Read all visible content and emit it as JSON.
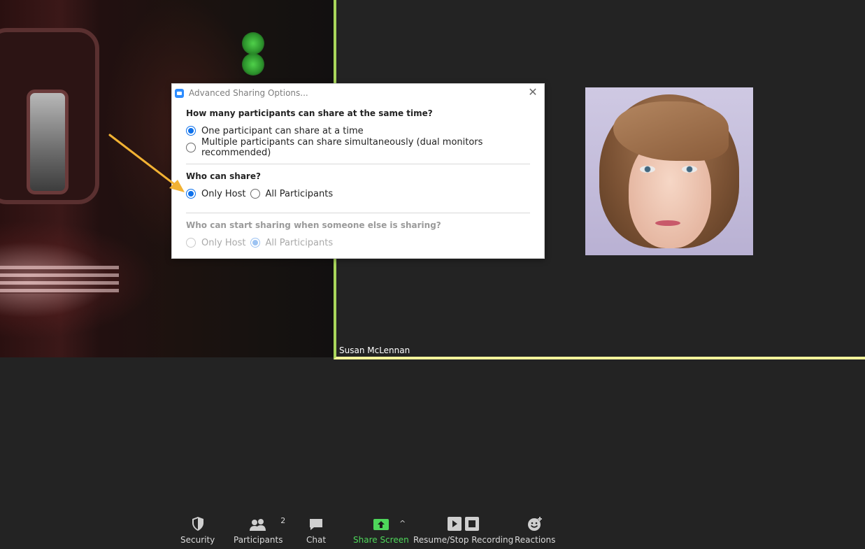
{
  "dialog": {
    "title": "Advanced Sharing Options...",
    "q1": "How many participants can share at the same time?",
    "q1_options": [
      "One participant can share at a time",
      "Multiple participants can share simultaneously (dual monitors recommended)"
    ],
    "q2": "Who can share?",
    "q2_options": [
      "Only Host",
      "All Participants"
    ],
    "q3": "Who can start sharing when someone else is sharing?",
    "q3_options": [
      "Only Host",
      "All Participants"
    ]
  },
  "video": {
    "participant_name": "Susan McLennan"
  },
  "toolbar": {
    "security": "Security",
    "participants": "Participants",
    "participants_count": "2",
    "chat": "Chat",
    "share_screen": "Share Screen",
    "recording": "Resume/Stop Recording",
    "reactions": "Reactions"
  },
  "colors": {
    "accent_blue": "#0e71eb",
    "share_green": "#4ed65a",
    "active_speaker_border": "#a9d65b",
    "annotation_arrow": "#f2b233"
  }
}
